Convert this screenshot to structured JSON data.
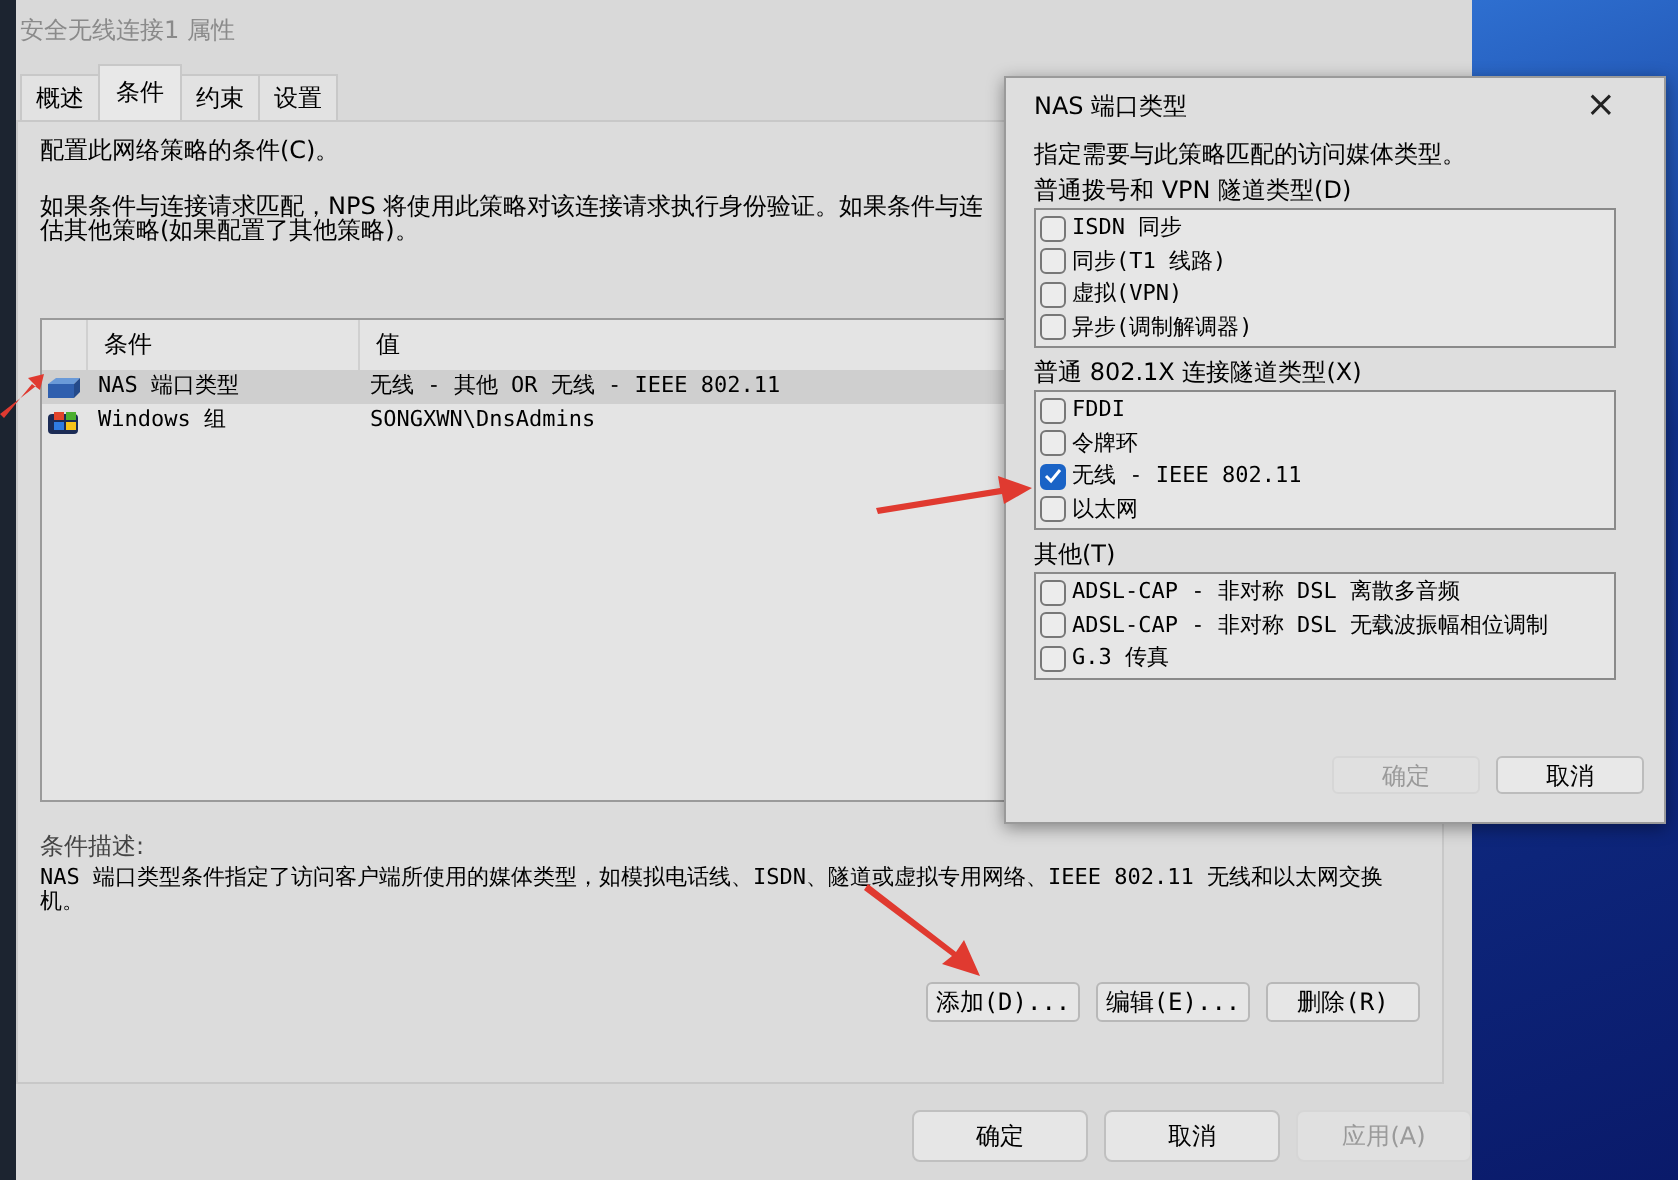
{
  "window": {
    "title": "安全无线连接1 属性"
  },
  "tabs": [
    {
      "label": "概述",
      "selected": false
    },
    {
      "label": "条件",
      "selected": true
    },
    {
      "label": "约束",
      "selected": false
    },
    {
      "label": "设置",
      "selected": false
    }
  ],
  "heading": "配置此网络策略的条件(C)。",
  "intro_lines": [
    "如果条件与连接请求匹配，NPS 将使用此策略对该连接请求执行身份验证。如果条件与连",
    "估其他策略(如果配置了其他策略)。"
  ],
  "table": {
    "columns": [
      "条件",
      "值"
    ],
    "rows": [
      {
        "kind": "nas",
        "condition": "NAS 端口类型",
        "value": "无线 - 其他 OR 无线 - IEEE 802.11",
        "selected": true
      },
      {
        "kind": "group",
        "condition": "Windows 组",
        "value": "SONGXWN\\DnsAdmins",
        "selected": false
      }
    ]
  },
  "description": {
    "label": "条件描述:",
    "text": "NAS 端口类型条件指定了访问客户端所使用的媒体类型，如模拟电话线、ISDN、隧道或虚拟专用网络、IEEE 802.11 无线和以太网交换机。"
  },
  "condition_buttons": [
    "添加(D)...",
    "编辑(E)...",
    "删除(R)"
  ],
  "footer_buttons": [
    {
      "label": "确定",
      "disabled": false
    },
    {
      "label": "取消",
      "disabled": false
    },
    {
      "label": "应用(A)",
      "disabled": true
    }
  ],
  "dialog": {
    "title": "NAS 端口类型",
    "close": "×",
    "instruction": "指定需要与此策略匹配的访问媒体类型。",
    "groups": [
      {
        "label": "普通拨号和 VPN 隧道类型(D)",
        "items": [
          {
            "label": "ISDN 同步",
            "checked": false
          },
          {
            "label": "同步(T1 线路)",
            "checked": false
          },
          {
            "label": "虚拟(VPN)",
            "checked": false
          },
          {
            "label": "异步(调制解调器)",
            "checked": false
          }
        ]
      },
      {
        "label": "普通 802.1X 连接隧道类型(X)",
        "items": [
          {
            "label": "FDDI",
            "checked": false
          },
          {
            "label": "令牌环",
            "checked": false
          },
          {
            "label": "无线 - IEEE 802.11",
            "checked": true
          },
          {
            "label": "以太网",
            "checked": false
          }
        ]
      },
      {
        "label": "其他(T)",
        "items": [
          {
            "label": "ADSL-CAP - 非对称 DSL 离散多音频",
            "checked": false
          },
          {
            "label": "ADSL-CAP - 非对称 DSL 无载波振幅相位调制",
            "checked": false
          },
          {
            "label": "G.3 传真",
            "checked": false
          }
        ]
      }
    ],
    "buttons": [
      {
        "label": "确定",
        "disabled": true
      },
      {
        "label": "取消",
        "disabled": false
      }
    ]
  }
}
